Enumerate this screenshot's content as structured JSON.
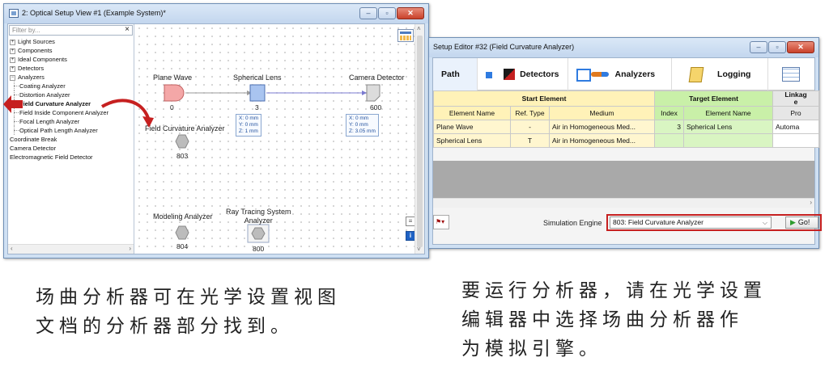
{
  "window1": {
    "title": "2: Optical Setup View #1 (Example System)*",
    "filter_placeholder": "Filter by...",
    "filter_clear": "×",
    "tree": [
      {
        "label": "Light Sources",
        "expander": "+",
        "level": 0
      },
      {
        "label": "Components",
        "expander": "+",
        "level": 0
      },
      {
        "label": "Ideal Components",
        "expander": "+",
        "level": 0
      },
      {
        "label": "Detectors",
        "expander": "+",
        "level": 0
      },
      {
        "label": "Analyzers",
        "expander": "−",
        "level": 0
      },
      {
        "label": "Coating Analyzer",
        "level": 1
      },
      {
        "label": "Distortion Analyzer",
        "level": 1
      },
      {
        "label": "Field Curvature Analyzer",
        "level": 1,
        "selected": true
      },
      {
        "label": "Field Inside Component Analyzer",
        "level": 1
      },
      {
        "label": "Focal Length Analyzer",
        "level": 1
      },
      {
        "label": "Optical Path Length Analyzer",
        "level": 1
      },
      {
        "label": "Coordinate Break",
        "level": 0
      },
      {
        "label": "Camera Detector",
        "level": 0
      },
      {
        "label": "Electromagnetic Field Detector",
        "level": 0
      }
    ],
    "nodes": {
      "plane_wave": {
        "label": "Plane Wave",
        "index": "0"
      },
      "spherical_lens": {
        "label": "Spherical Lens",
        "index": "3",
        "info": [
          "X: 0 mm",
          "Y: 0 mm",
          "Z: 1 mm"
        ]
      },
      "camera_detector": {
        "label": "Camera Detector",
        "index": "600",
        "info": [
          "X: 0 mm",
          "Y: 0 mm",
          "Z: 3.05 mm"
        ]
      },
      "field_curvature": {
        "label": "Field Curvature Analyzer",
        "index": "803"
      },
      "modeling": {
        "label": "Modeling Analyzer",
        "index": "804"
      },
      "ray_tracing": {
        "label_line1": "Ray Tracing System",
        "label_line2": "Analyzer",
        "index": "800"
      }
    }
  },
  "window2": {
    "title": "Setup Editor #32 (Field Curvature Analyzer)",
    "tabs": [
      {
        "label": "Path",
        "icon": "path-icon"
      },
      {
        "label": "Detectors",
        "icon": "detectors-icon"
      },
      {
        "label": "Analyzers",
        "icon": "analyzers-icon"
      },
      {
        "label": "Logging",
        "icon": "logging-icon"
      }
    ],
    "table": {
      "group_headers": {
        "start": "Start Element",
        "target": "Target Element",
        "linkage_line1": "Linkag",
        "linkage_line2": "e"
      },
      "columns": [
        "Element Name",
        "Ref. Type",
        "Medium",
        "Index",
        "Element Name",
        "Pro"
      ],
      "rows": [
        [
          "Plane Wave",
          "-",
          "Air in Homogeneous Med...",
          "3",
          "Spherical Lens",
          "Automa"
        ],
        [
          "Spherical Lens",
          "T",
          "Air in Homogeneous Med...",
          "",
          "",
          ""
        ]
      ]
    },
    "simulation_engine_label": "Simulation Engine",
    "simulation_engine_value": "803: Field Curvature Analyzer",
    "go_label": "Go!"
  },
  "captions": {
    "left_line1": "场曲分析器可在光学设置视图",
    "left_line2": "文档的分析器部分找到。",
    "right_line1": "要运行分析器，请在光学设置",
    "right_line2": "编辑器中选择场曲分析器作",
    "right_line3": "为模拟引擎。"
  },
  "colors": {
    "accent_red": "#c62020",
    "start_header": "#fff2b8",
    "target_header": "#c9f0a8",
    "link_blue": "#1f4f9c"
  }
}
